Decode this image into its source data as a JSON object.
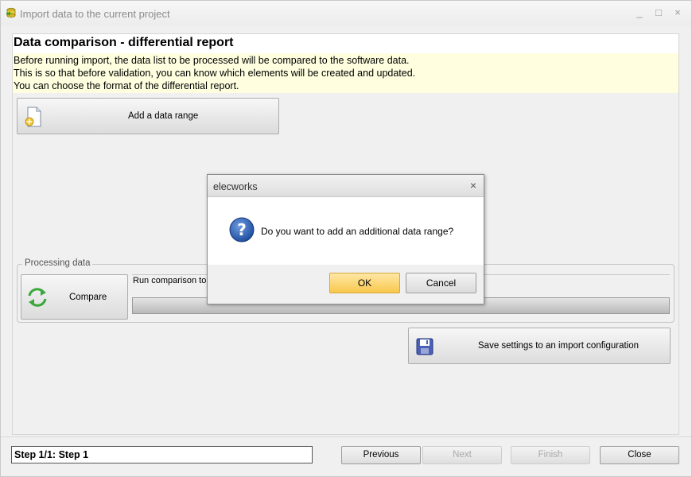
{
  "window": {
    "title": "Import data to the current project",
    "controls": [
      "_",
      "□",
      "×"
    ]
  },
  "page": {
    "heading": "Data comparison - differential report",
    "info_lines": [
      "Before running import, the data list to be processed will be compared to the software data.",
      "This is so that before validation, you can know which elements will be created and updated.",
      "You can choose the format of the differential report."
    ],
    "add_range_label": "Add a data range",
    "processing_group": "Processing data",
    "compare_label": "Compare",
    "run_text": "Run comparison to i",
    "save_settings_label": "Save settings to an import configuration"
  },
  "footer": {
    "step": "Step 1/1: Step 1",
    "previous": "Previous",
    "next": "Next",
    "finish": "Finish",
    "close": "Close"
  },
  "dialog": {
    "title": "elecworks",
    "close": "×",
    "message": "Do you want to add an additional data range?",
    "ok": "OK",
    "cancel": "Cancel"
  },
  "icons": [
    "app-icon",
    "add-document-icon",
    "compare-arrows-icon",
    "save-disk-icon",
    "question-icon"
  ],
  "colors": {
    "info_background": "#ffffe0",
    "ok_button": "#f8c84c",
    "question_icon": "#1f4fa0",
    "compare_icon": "#3aa83a"
  }
}
